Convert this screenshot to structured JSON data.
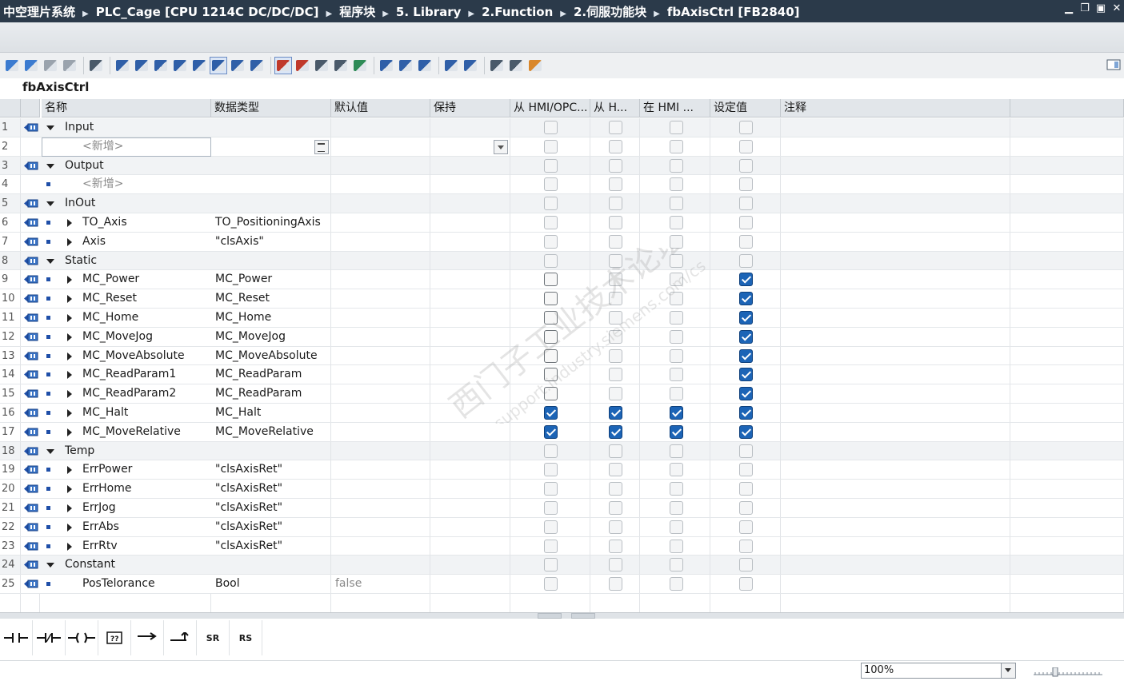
{
  "title_bar": {
    "breadcrumbs": [
      "中空理片系统",
      "PLC_Cage [CPU 1214C DC/DC/DC]",
      "程序块",
      "5. Library",
      "2.Function",
      "2.伺服功能块",
      "fbAxisCtrl [FB2840]"
    ]
  },
  "block_name": "fbAxisCtrl",
  "columns": [
    "名称",
    "数据类型",
    "默认值",
    "保持",
    "从 HMI/OPC...",
    "从 H...",
    "在 HMI ...",
    "设定值",
    "注释"
  ],
  "rows": [
    {
      "num": "1",
      "kind": "section",
      "name": "Input",
      "type": "",
      "def": "",
      "c": [
        0,
        0,
        0,
        0
      ]
    },
    {
      "num": "2",
      "kind": "new",
      "name": "<新增>",
      "type": "",
      "def": "",
      "c": [
        0,
        0,
        0,
        0
      ]
    },
    {
      "num": "3",
      "kind": "section",
      "name": "Output",
      "type": "",
      "def": "",
      "c": [
        0,
        0,
        0,
        0
      ]
    },
    {
      "num": "4",
      "kind": "newplain",
      "name": "<新增>",
      "type": "",
      "def": "",
      "c": [
        0,
        0,
        0,
        0
      ]
    },
    {
      "num": "5",
      "kind": "section",
      "name": "InOut",
      "type": "",
      "def": "",
      "c": [
        0,
        0,
        0,
        0
      ]
    },
    {
      "num": "6",
      "kind": "item",
      "name": "TO_Axis",
      "type": "TO_PositioningAxis",
      "def": "",
      "c": [
        0,
        0,
        0,
        0
      ]
    },
    {
      "num": "7",
      "kind": "item",
      "name": "Axis",
      "type": "\"clsAxis\"",
      "def": "",
      "c": [
        0,
        0,
        0,
        0
      ]
    },
    {
      "num": "8",
      "kind": "section",
      "name": "Static",
      "type": "",
      "def": "",
      "c": [
        0,
        0,
        0,
        0
      ]
    },
    {
      "num": "9",
      "kind": "item",
      "name": "MC_Power",
      "type": "MC_Power",
      "def": "",
      "c": [
        2,
        0,
        0,
        1
      ]
    },
    {
      "num": "10",
      "kind": "item",
      "name": "MC_Reset",
      "type": "MC_Reset",
      "def": "",
      "c": [
        2,
        0,
        0,
        1
      ]
    },
    {
      "num": "11",
      "kind": "item",
      "name": "MC_Home",
      "type": "MC_Home",
      "def": "",
      "c": [
        2,
        0,
        0,
        1
      ]
    },
    {
      "num": "12",
      "kind": "item",
      "name": "MC_MoveJog",
      "type": "MC_MoveJog",
      "def": "",
      "c": [
        2,
        0,
        0,
        1
      ]
    },
    {
      "num": "13",
      "kind": "item",
      "name": "MC_MoveAbsolute",
      "type": "MC_MoveAbsolute",
      "def": "",
      "c": [
        2,
        0,
        0,
        1
      ]
    },
    {
      "num": "14",
      "kind": "item",
      "name": "MC_ReadParam1",
      "type": "MC_ReadParam",
      "def": "",
      "c": [
        2,
        0,
        0,
        1
      ]
    },
    {
      "num": "15",
      "kind": "item",
      "name": "MC_ReadParam2",
      "type": "MC_ReadParam",
      "def": "",
      "c": [
        2,
        0,
        0,
        1
      ]
    },
    {
      "num": "16",
      "kind": "item",
      "name": "MC_Halt",
      "type": "MC_Halt",
      "def": "",
      "c": [
        1,
        1,
        1,
        1
      ]
    },
    {
      "num": "17",
      "kind": "item",
      "name": "MC_MoveRelative",
      "type": "MC_MoveRelative",
      "def": "",
      "c": [
        1,
        1,
        1,
        1
      ]
    },
    {
      "num": "18",
      "kind": "section",
      "name": "Temp",
      "type": "",
      "def": "",
      "c": [
        0,
        0,
        0,
        0
      ]
    },
    {
      "num": "19",
      "kind": "item",
      "name": "ErrPower",
      "type": "\"clsAxisRet\"",
      "def": "",
      "c": [
        0,
        0,
        0,
        0
      ]
    },
    {
      "num": "20",
      "kind": "item",
      "name": "ErrHome",
      "type": "\"clsAxisRet\"",
      "def": "",
      "c": [
        0,
        0,
        0,
        0
      ]
    },
    {
      "num": "21",
      "kind": "item",
      "name": "ErrJog",
      "type": "\"clsAxisRet\"",
      "def": "",
      "c": [
        0,
        0,
        0,
        0
      ]
    },
    {
      "num": "22",
      "kind": "item",
      "name": "ErrAbs",
      "type": "\"clsAxisRet\"",
      "def": "",
      "c": [
        0,
        0,
        0,
        0
      ]
    },
    {
      "num": "23",
      "kind": "item",
      "name": "ErrRtv",
      "type": "\"clsAxisRet\"",
      "def": "",
      "c": [
        0,
        0,
        0,
        0
      ]
    },
    {
      "num": "24",
      "kind": "section",
      "name": "Constant",
      "type": "",
      "def": "",
      "c": [
        0,
        0,
        0,
        0
      ]
    },
    {
      "num": "25",
      "kind": "leaf",
      "name": "PosTelorance",
      "type": "Bool",
      "def": "false",
      "c": [
        0,
        0,
        0,
        0
      ]
    }
  ],
  "ladder_tools": [
    {
      "icon": "no-contact-icon",
      "label": ""
    },
    {
      "icon": "nc-contact-icon",
      "label": ""
    },
    {
      "icon": "coil-icon",
      "label": ""
    },
    {
      "icon": "empty-box-icon",
      "label": ""
    },
    {
      "icon": "open-branch-icon",
      "label": ""
    },
    {
      "icon": "close-branch-icon",
      "label": ""
    },
    {
      "icon": "sr-icon",
      "label": "SR"
    },
    {
      "icon": "rs-icon",
      "label": "RS"
    }
  ],
  "watermark": {
    "line1": "西门子工业技术论坛",
    "line2": "support.industry.siemens.com/cs"
  },
  "zoom": "100%",
  "colors": {
    "titlebar": "#2b3a4a",
    "checked": "#1c64b6",
    "header": "#e2e6ea"
  }
}
